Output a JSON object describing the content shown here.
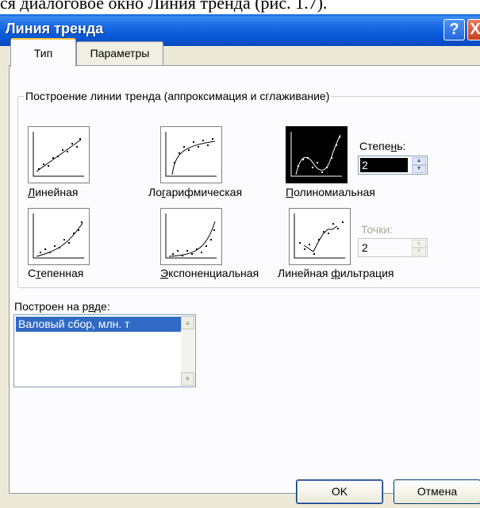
{
  "doc_text": "ся диалоговое окно Линия тренда (рис. 1.7).",
  "window": {
    "title": "Линия тренда",
    "help_label": "?",
    "close_label": "X"
  },
  "tabs": [
    {
      "label": "Тип",
      "active": true
    },
    {
      "label": "Параметры",
      "active": false
    }
  ],
  "group": {
    "label": "Построение линии тренда (аппроксимация и сглаживание)",
    "options": [
      {
        "label_before": "",
        "mnemonic": "Л",
        "label_after": "инейная",
        "icon": "linear-trend-icon"
      },
      {
        "label_before": "Ло",
        "mnemonic": "г",
        "label_after": "арифмическая",
        "icon": "logarithmic-trend-icon"
      },
      {
        "label_before": "",
        "mnemonic": "П",
        "label_after": "олиномиальная",
        "icon": "polynomial-trend-icon",
        "selected": true
      },
      {
        "label_before": "С",
        "mnemonic": "т",
        "label_after": "епенная",
        "icon": "power-trend-icon"
      },
      {
        "label_before": "",
        "mnemonic": "Э",
        "label_after": "кспоненциальная",
        "icon": "exponential-trend-icon"
      },
      {
        "label_before": "Линейная ",
        "mnemonic": "ф",
        "label_after": "ильтрация",
        "icon": "moving-average-trend-icon"
      }
    ],
    "degree": {
      "label_before": "Степе",
      "mnemonic": "н",
      "label_after": "ь:",
      "value": "2"
    },
    "points": {
      "label": "Точки:",
      "value": "2"
    }
  },
  "series": {
    "label_before": "Построен на р",
    "mnemonic": "я",
    "label_after": "де:",
    "items": [
      "Валовый сбор, млн. т"
    ]
  },
  "buttons": {
    "ok": "OK",
    "cancel": "Отмена"
  },
  "colors": {
    "title_bar": "#0a5fd8",
    "selection": "#316ac5",
    "dialog_bg": "#ece9d8",
    "tab_accent": "#ffc83c"
  }
}
